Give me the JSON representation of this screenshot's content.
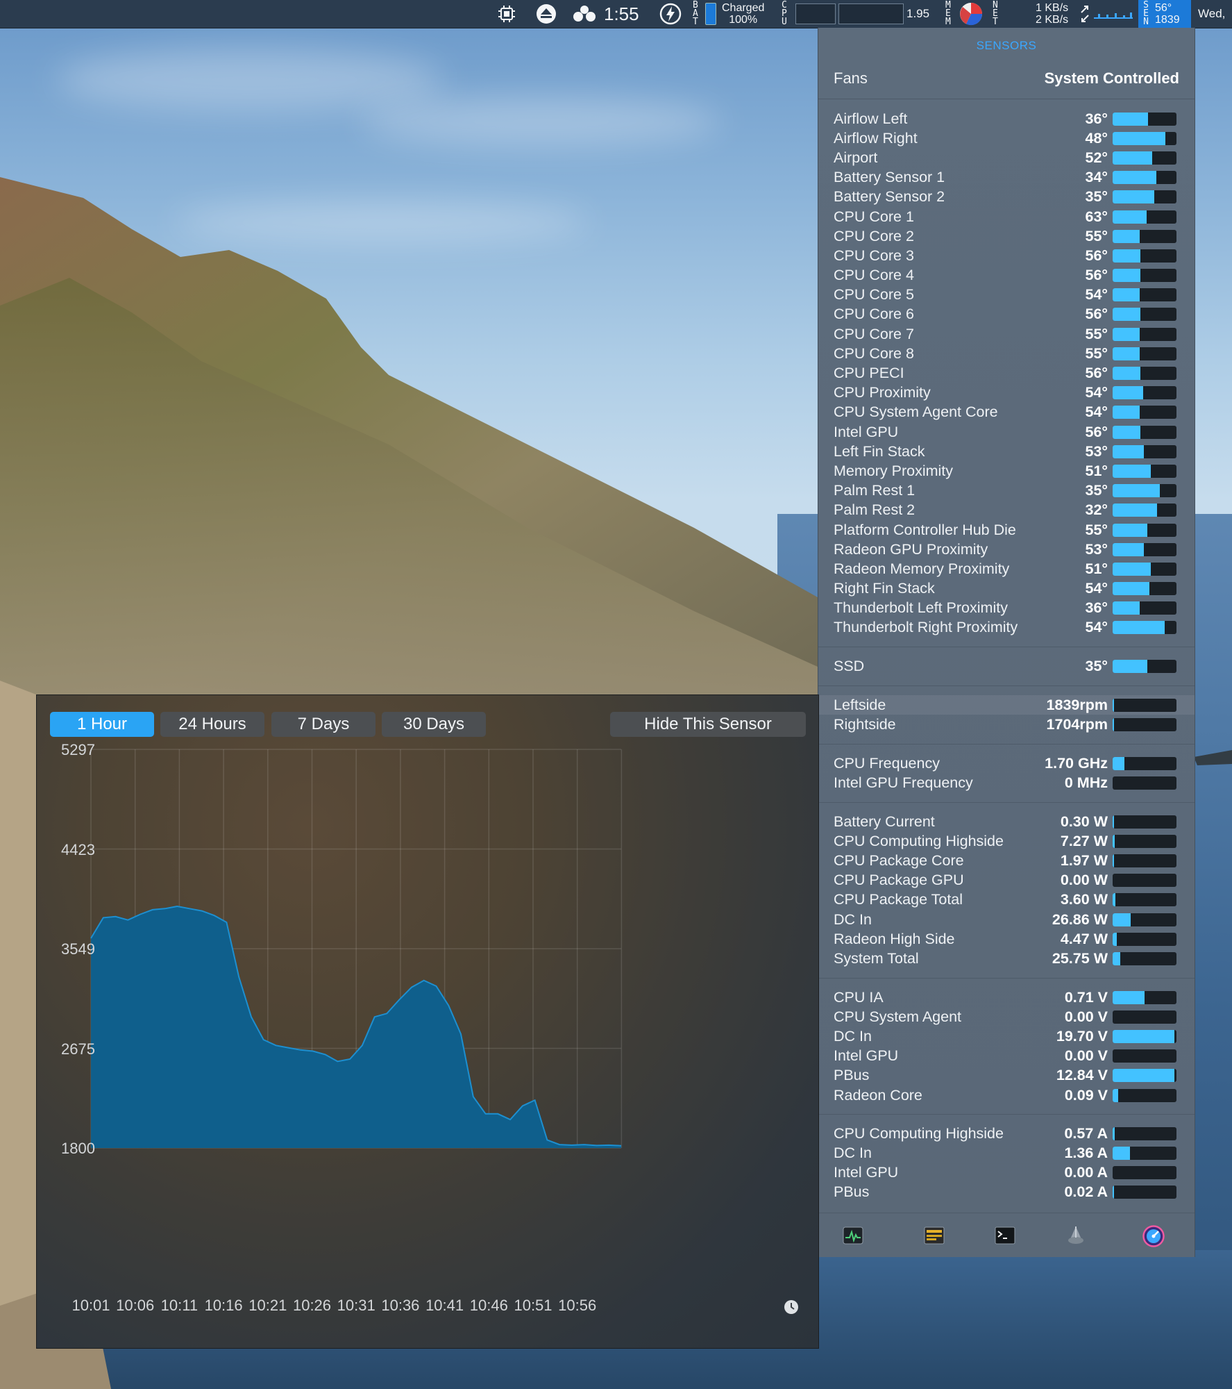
{
  "menubar": {
    "time": "1:55",
    "bat_label": "B\nA\nT",
    "battery_status_line1": "Charged",
    "battery_status_line2": "100%",
    "cpu_label": "C\nP\nU",
    "load_value": "1.95",
    "mem_label": "M\nE\nM",
    "net_label": "N\nE\nT",
    "net_up": "1 KB/s",
    "net_down": "2 KB/s",
    "sens_label": "S\nE\nN",
    "sens_temp": "56°",
    "sens_rpm": "1839",
    "date": "Wed,"
  },
  "sensors_panel": {
    "title": "SENSORS",
    "fans_label": "Fans",
    "fans_mode": "System Controlled",
    "temperatures": [
      {
        "name": "Airflow Left",
        "value": "36°",
        "level": 0.55
      },
      {
        "name": "Airflow Right",
        "value": "48°",
        "level": 0.83
      },
      {
        "name": "Airport",
        "value": "52°",
        "level": 0.62
      },
      {
        "name": "Battery Sensor 1",
        "value": "34°",
        "level": 0.68
      },
      {
        "name": "Battery Sensor 2",
        "value": "35°",
        "level": 0.65
      },
      {
        "name": "CPU Core 1",
        "value": "63°",
        "level": 0.53
      },
      {
        "name": "CPU Core 2",
        "value": "55°",
        "level": 0.42
      },
      {
        "name": "CPU Core 3",
        "value": "56°",
        "level": 0.43
      },
      {
        "name": "CPU Core 4",
        "value": "56°",
        "level": 0.43
      },
      {
        "name": "CPU Core 5",
        "value": "54°",
        "level": 0.42
      },
      {
        "name": "CPU Core 6",
        "value": "56°",
        "level": 0.43
      },
      {
        "name": "CPU Core 7",
        "value": "55°",
        "level": 0.42
      },
      {
        "name": "CPU Core 8",
        "value": "55°",
        "level": 0.42
      },
      {
        "name": "CPU PECI",
        "value": "56°",
        "level": 0.43
      },
      {
        "name": "CPU Proximity",
        "value": "54°",
        "level": 0.48
      },
      {
        "name": "CPU System Agent Core",
        "value": "54°",
        "level": 0.42
      },
      {
        "name": "Intel GPU",
        "value": "56°",
        "level": 0.43
      },
      {
        "name": "Left Fin Stack",
        "value": "53°",
        "level": 0.49
      },
      {
        "name": "Memory Proximity",
        "value": "51°",
        "level": 0.6
      },
      {
        "name": "Palm Rest 1",
        "value": "35°",
        "level": 0.74
      },
      {
        "name": "Palm Rest 2",
        "value": "32°",
        "level": 0.7
      },
      {
        "name": "Platform Controller Hub Die",
        "value": "55°",
        "level": 0.54
      },
      {
        "name": "Radeon GPU Proximity",
        "value": "53°",
        "level": 0.49
      },
      {
        "name": "Radeon Memory Proximity",
        "value": "51°",
        "level": 0.6
      },
      {
        "name": "Right Fin Stack",
        "value": "54°",
        "level": 0.58
      },
      {
        "name": "Thunderbolt Left Proximity",
        "value": "36°",
        "level": 0.42
      },
      {
        "name": "Thunderbolt Right Proximity",
        "value": "54°",
        "level": 0.82
      }
    ],
    "ssd": [
      {
        "name": "SSD",
        "value": "35°",
        "level": 0.54
      }
    ],
    "fans": [
      {
        "name": "Leftside",
        "value": "1839rpm",
        "level": 0.02
      },
      {
        "name": "Rightside",
        "value": "1704rpm",
        "level": 0.02
      }
    ],
    "frequencies": [
      {
        "name": "CPU Frequency",
        "value": "1.70 GHz",
        "level": 0.18
      },
      {
        "name": "Intel GPU Frequency",
        "value": "0 MHz",
        "level": 0.0
      }
    ],
    "power": [
      {
        "name": "Battery Current",
        "value": "0.30 W",
        "level": 0.02
      },
      {
        "name": "CPU Computing Highside",
        "value": "7.27 W",
        "level": 0.03
      },
      {
        "name": "CPU Package Core",
        "value": "1.97 W",
        "level": 0.02
      },
      {
        "name": "CPU Package GPU",
        "value": "0.00 W",
        "level": 0.0
      },
      {
        "name": "CPU Package Total",
        "value": "3.60 W",
        "level": 0.04
      },
      {
        "name": "DC In",
        "value": "26.86 W",
        "level": 0.28
      },
      {
        "name": "Radeon High Side",
        "value": "4.47 W",
        "level": 0.06
      },
      {
        "name": "System Total",
        "value": "25.75 W",
        "level": 0.12
      }
    ],
    "voltages": [
      {
        "name": "CPU IA",
        "value": "0.71 V",
        "level": 0.5
      },
      {
        "name": "CPU System Agent",
        "value": "0.00 V",
        "level": 0.0
      },
      {
        "name": "DC In",
        "value": "19.70 V",
        "level": 0.97
      },
      {
        "name": "Intel GPU",
        "value": "0.00 V",
        "level": 0.0
      },
      {
        "name": "PBus",
        "value": "12.84 V",
        "level": 0.97
      },
      {
        "name": "Radeon Core",
        "value": "0.09 V",
        "level": 0.09
      }
    ],
    "currents": [
      {
        "name": "CPU Computing Highside",
        "value": "0.57 A",
        "level": 0.03
      },
      {
        "name": "DC In",
        "value": "1.36 A",
        "level": 0.27
      },
      {
        "name": "Intel GPU",
        "value": "0.00 A",
        "level": 0.0
      },
      {
        "name": "PBus",
        "value": "0.02 A",
        "level": 0.02
      }
    ],
    "tool_icons": [
      "activity-monitor-icon",
      "console-icon",
      "terminal-icon",
      "disk-utility-icon",
      "istat-icon"
    ]
  },
  "graph_window": {
    "range_buttons": [
      "1 Hour",
      "24 Hours",
      "7 Days",
      "30 Days"
    ],
    "active_range": "1 Hour",
    "hide_button": "Hide This Sensor",
    "accent": "#2aa4f4",
    "fill_color": "#0f5f8c",
    "line_color": "#1d8fd0"
  },
  "chart_data": {
    "type": "area",
    "y_ticks": [
      "5297",
      "4423",
      "3549",
      "2675",
      "1800"
    ],
    "ylim": [
      1800,
      5297
    ],
    "x_ticks": [
      "10:01",
      "10:06",
      "10:11",
      "10:16",
      "10:21",
      "10:26",
      "10:31",
      "10:36",
      "10:41",
      "10:46",
      "10:51",
      "10:56"
    ],
    "series": [
      {
        "points": [
          [
            0,
            3640
          ],
          [
            1,
            3820
          ],
          [
            2,
            3830
          ],
          [
            3,
            3800
          ],
          [
            4,
            3850
          ],
          [
            5,
            3890
          ],
          [
            6,
            3900
          ],
          [
            7,
            3920
          ],
          [
            8,
            3900
          ],
          [
            9,
            3880
          ],
          [
            10,
            3840
          ],
          [
            11,
            3780
          ],
          [
            12,
            3300
          ],
          [
            13,
            2950
          ],
          [
            14,
            2750
          ],
          [
            15,
            2700
          ],
          [
            16,
            2680
          ],
          [
            17,
            2660
          ],
          [
            18,
            2650
          ],
          [
            19,
            2620
          ],
          [
            20,
            2560
          ],
          [
            21,
            2580
          ],
          [
            22,
            2700
          ],
          [
            23,
            2950
          ],
          [
            24,
            2980
          ],
          [
            25,
            3100
          ],
          [
            26,
            3210
          ],
          [
            27,
            3270
          ],
          [
            28,
            3220
          ],
          [
            29,
            3050
          ],
          [
            30,
            2800
          ],
          [
            31,
            2250
          ],
          [
            32,
            2100
          ],
          [
            33,
            2100
          ],
          [
            34,
            2050
          ],
          [
            35,
            2170
          ],
          [
            36,
            2220
          ],
          [
            37,
            1870
          ],
          [
            38,
            1830
          ],
          [
            39,
            1825
          ],
          [
            40,
            1830
          ],
          [
            41,
            1822
          ],
          [
            42,
            1825
          ],
          [
            43,
            1820
          ]
        ],
        "x_start": "10:01",
        "x_end": "10:58"
      }
    ],
    "grid": true,
    "legend": "none"
  }
}
